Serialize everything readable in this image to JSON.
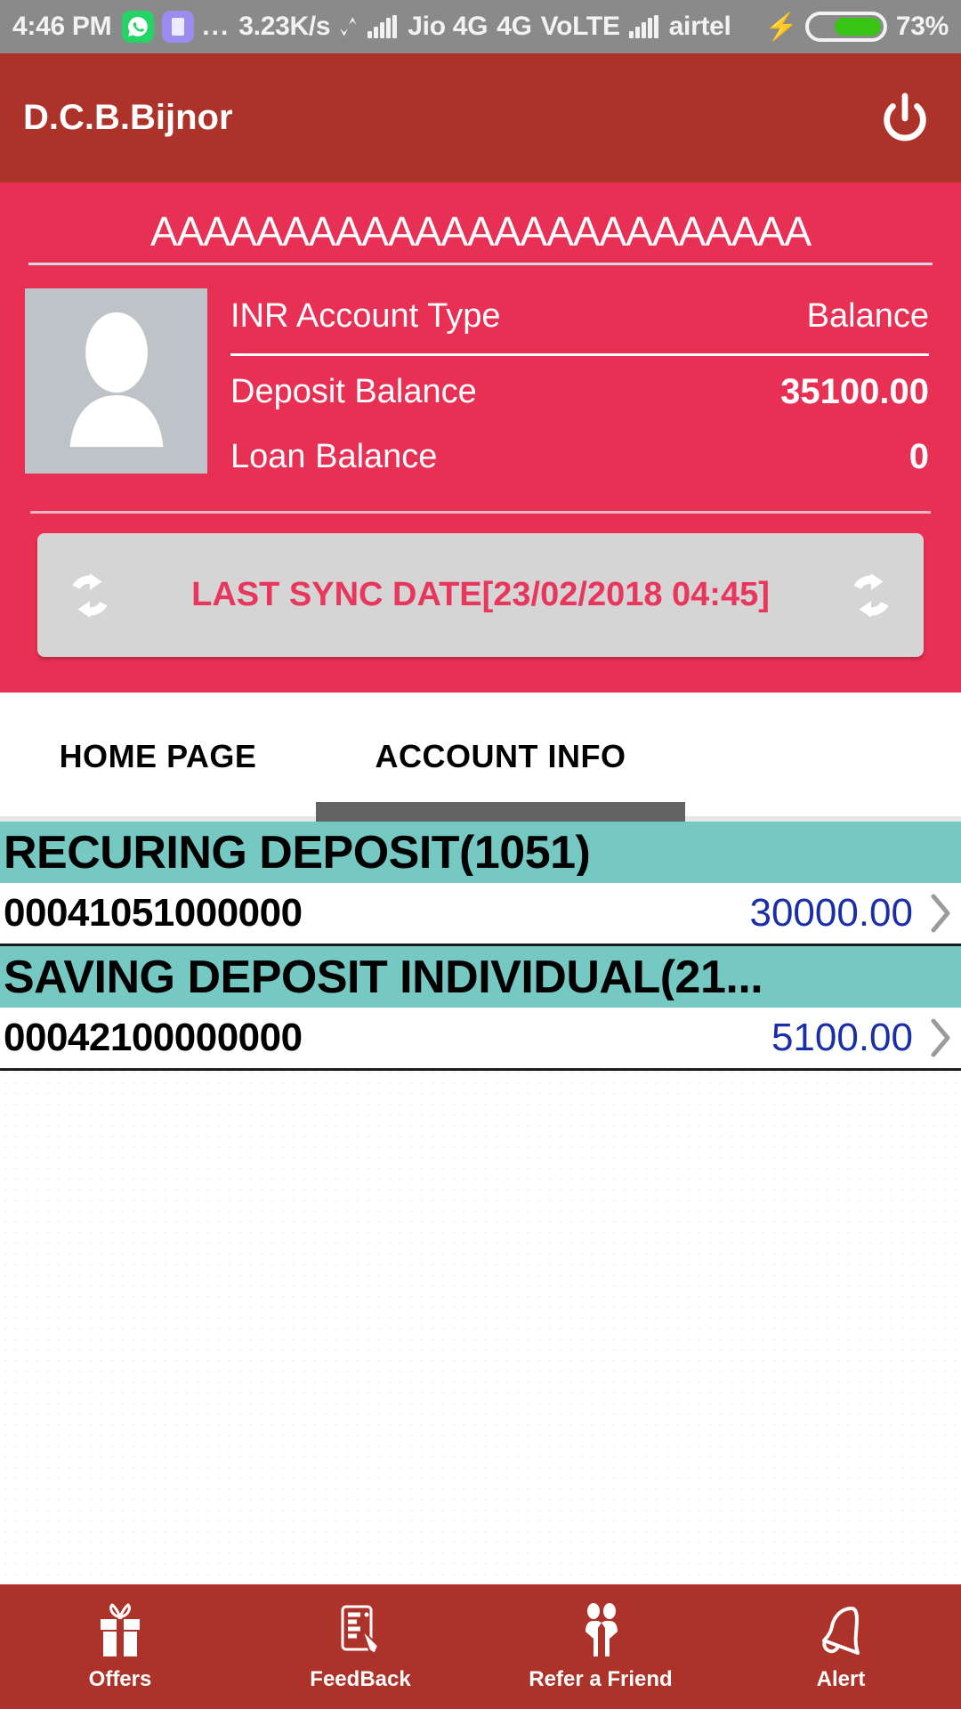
{
  "statusbar": {
    "time": "4:46 PM",
    "whatsapp_icon": "whatsapp-icon",
    "purple_app_icon": "app-icon",
    "overflow_dots": "...",
    "network_speed": "3.23K/s",
    "data_transfer_icon": "data-transfer-arrows-icon",
    "sim1_signal_icon": "signal-bars-icon",
    "sim1_carrier": "Jio 4G",
    "network_type": "4G",
    "volte": "VoLTE",
    "sim2_signal_icon": "signal-bars-icon",
    "sim2_carrier": "airtel",
    "charging_icon": "lightning-bolt-icon",
    "battery_icon": "battery-icon",
    "battery_percent": "73%"
  },
  "appbar": {
    "title": "D.C.B.Bijnor",
    "power_icon": "power-icon"
  },
  "profile": {
    "account_holder_name": "AAAAAAAAAAAAAAAAAAAAAAAAA",
    "avatar_icon": "user-avatar-icon",
    "table": {
      "header": {
        "label": "INR Account Type",
        "value": "Balance"
      },
      "rows": [
        {
          "label": "Deposit Balance",
          "value": "35100.00"
        },
        {
          "label": "Loan Balance",
          "value": "0"
        }
      ]
    },
    "sync": {
      "left_icon": "refresh-icon",
      "right_icon": "refresh-icon",
      "label": "LAST SYNC DATE[23/02/2018 04:45]"
    }
  },
  "tabs": [
    {
      "label": "HOME PAGE",
      "selected": false
    },
    {
      "label": "ACCOUNT INFO",
      "selected": true
    }
  ],
  "account_groups": [
    {
      "title": "RECURING DEPOSIT(1051)",
      "accounts": [
        {
          "number": "00041051000000",
          "amount": "30000.00",
          "chevron_icon": "chevron-right-icon"
        }
      ]
    },
    {
      "title": "SAVING DEPOSIT INDIVIDUAL(21...",
      "accounts": [
        {
          "number": "00042100000000",
          "amount": "5100.00",
          "chevron_icon": "chevron-right-icon"
        }
      ]
    }
  ],
  "bottomnav": [
    {
      "label": "Offers",
      "icon": "gift-icon"
    },
    {
      "label": "FeedBack",
      "icon": "feedback-form-pencil-icon"
    },
    {
      "label": "Refer a Friend",
      "icon": "two-people-icon"
    },
    {
      "label": "Alert",
      "icon": "bell-icon"
    }
  ],
  "colors": {
    "appbar_red": "#ad3229",
    "profile_pink": "#e82f54",
    "group_teal": "#76c9c2",
    "amount_blue": "#1a2ea8",
    "sync_text_red": "#e8365c",
    "battery_green": "#38c415"
  }
}
